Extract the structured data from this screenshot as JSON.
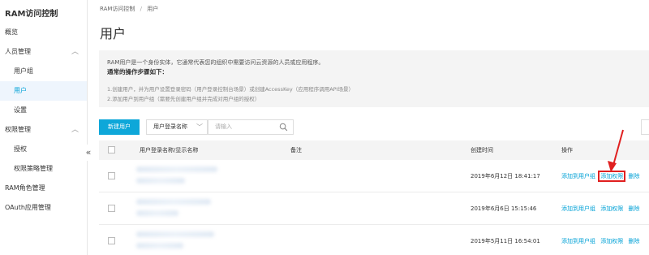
{
  "sidebar": {
    "title": "RAM访问控制",
    "items": [
      {
        "label": "概览"
      },
      {
        "label": "人员管理"
      },
      {
        "label": "用户组"
      },
      {
        "label": "用户"
      },
      {
        "label": "设置"
      },
      {
        "label": "权限管理"
      },
      {
        "label": "授权"
      },
      {
        "label": "权限策略管理"
      },
      {
        "label": "RAM角色管理"
      },
      {
        "label": "OAuth应用管理"
      }
    ],
    "collapse_glyph": "«"
  },
  "breadcrumb": {
    "root": "RAM访问控制",
    "separator": "/",
    "current": "用户"
  },
  "page_title": "用户",
  "info": {
    "line1": "RAM用户是一个身份实体，它通常代表您的组织中需要访问云资源的人员或应用程序。",
    "line2": "通常的操作步骤如下：",
    "line3": "1.创建用户，并为用户设置登录密码（用户登录控制台场景）或创建AccessKey（应用程序调用API场景）",
    "line4": "2.添加用户到用户组（需要先创建用户组并完成对用户组的授权）"
  },
  "toolbar": {
    "new_user": "新建用户",
    "select_value": "用户登录名称",
    "search_placeholder": "请输入"
  },
  "table": {
    "headers": {
      "name": "用户登录名称/显示名称",
      "note": "备注",
      "created": "创建时间",
      "actions": "操作"
    },
    "rows": [
      {
        "created": "2019年6月12日 18:41:17"
      },
      {
        "created": "2019年6月6日 15:15:46"
      },
      {
        "created": "2019年5月11日 16:54:01"
      }
    ],
    "action_labels": {
      "add_to_group": "添加到用户组",
      "add_permission": "添加权限",
      "delete": "删除"
    }
  },
  "colors": {
    "accent": "#0ea7d9",
    "link": "#00a1d6",
    "annotation": "#e02020"
  }
}
